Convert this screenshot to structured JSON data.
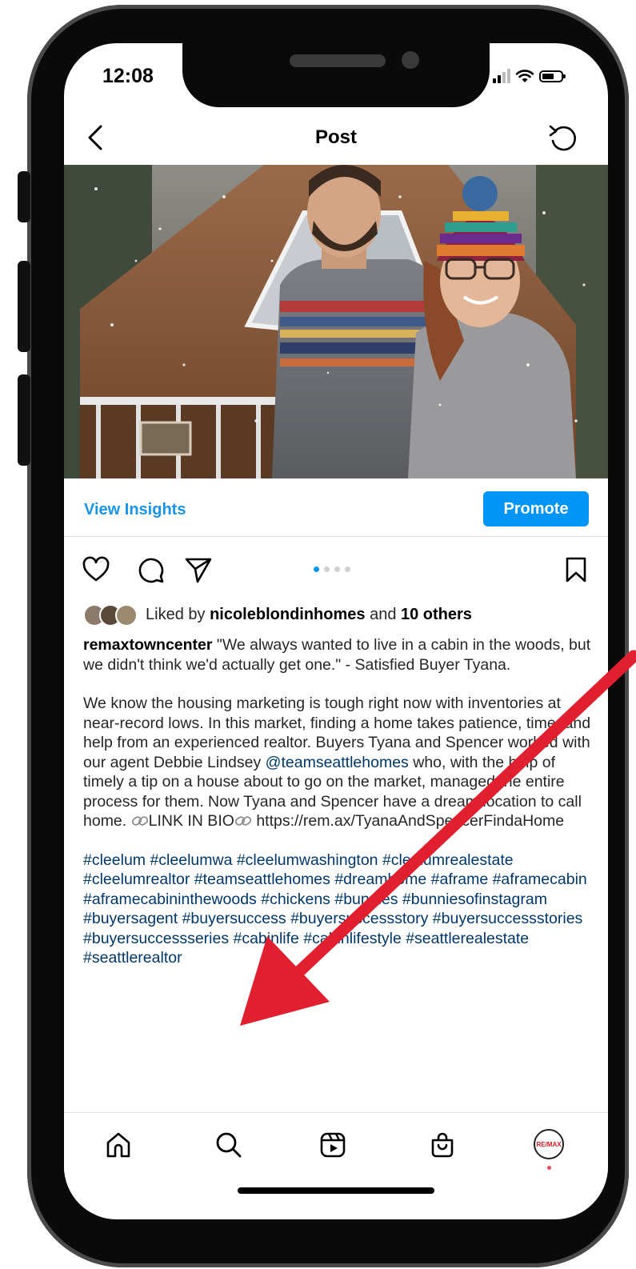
{
  "status_bar": {
    "time": "12:08"
  },
  "header": {
    "title": "Post"
  },
  "insights": {
    "view_insights_label": "View Insights",
    "promote_label": "Promote"
  },
  "carousel": {
    "total": 4,
    "active_index": 0
  },
  "likes": {
    "prefix": "Liked by ",
    "user": "nicoleblondinhomes",
    "connector": " and ",
    "others": "10 others"
  },
  "caption": {
    "username": "remaxtowncenter",
    "quote": " \"We always wanted to live in a cabin in the woods, but we didn't think we'd actually get one.\" - Satisfied Buyer Tyana.",
    "body_1": "We know the housing marketing is tough right now with inventories at near-record lows. In this market, finding a home takes patience, time, and help from an experienced realtor. Buyers Tyana and Spencer worked with our agent Debbie Lindsey ",
    "mention": "@teamseattlehomes",
    "body_2": "  who, with the help of timely a tip on a house about to go on the market, managed the entire process for them. Now Tyana and Spencer have a dream location to call home. ",
    "link_in_bio": "LINK IN BIO",
    "url": " https://rem.ax/TyanaAndSpencerFindaHome",
    "hashtags": "#cleelum #cleelumwa #cleelumwashington #cleelumrealestate #cleelumrealtor #teamseattlehomes #dreamhome #aframe #aframecabin #aframecabininthewoods #chickens #bunnies #bunniesofinstagram #buyersagent #buyersuccess #buyersuccessstory #buyersuccessstories #buyersuccessseries #cabinlife #cabinlifestyle #seattlerealestate #seattlerealtor"
  },
  "profile": {
    "avatar_text": "RE/MAX"
  },
  "colors": {
    "accent": "#0095f6",
    "link": "#00376b",
    "insights": "#1a94e8",
    "arrow": "#e0202e"
  }
}
